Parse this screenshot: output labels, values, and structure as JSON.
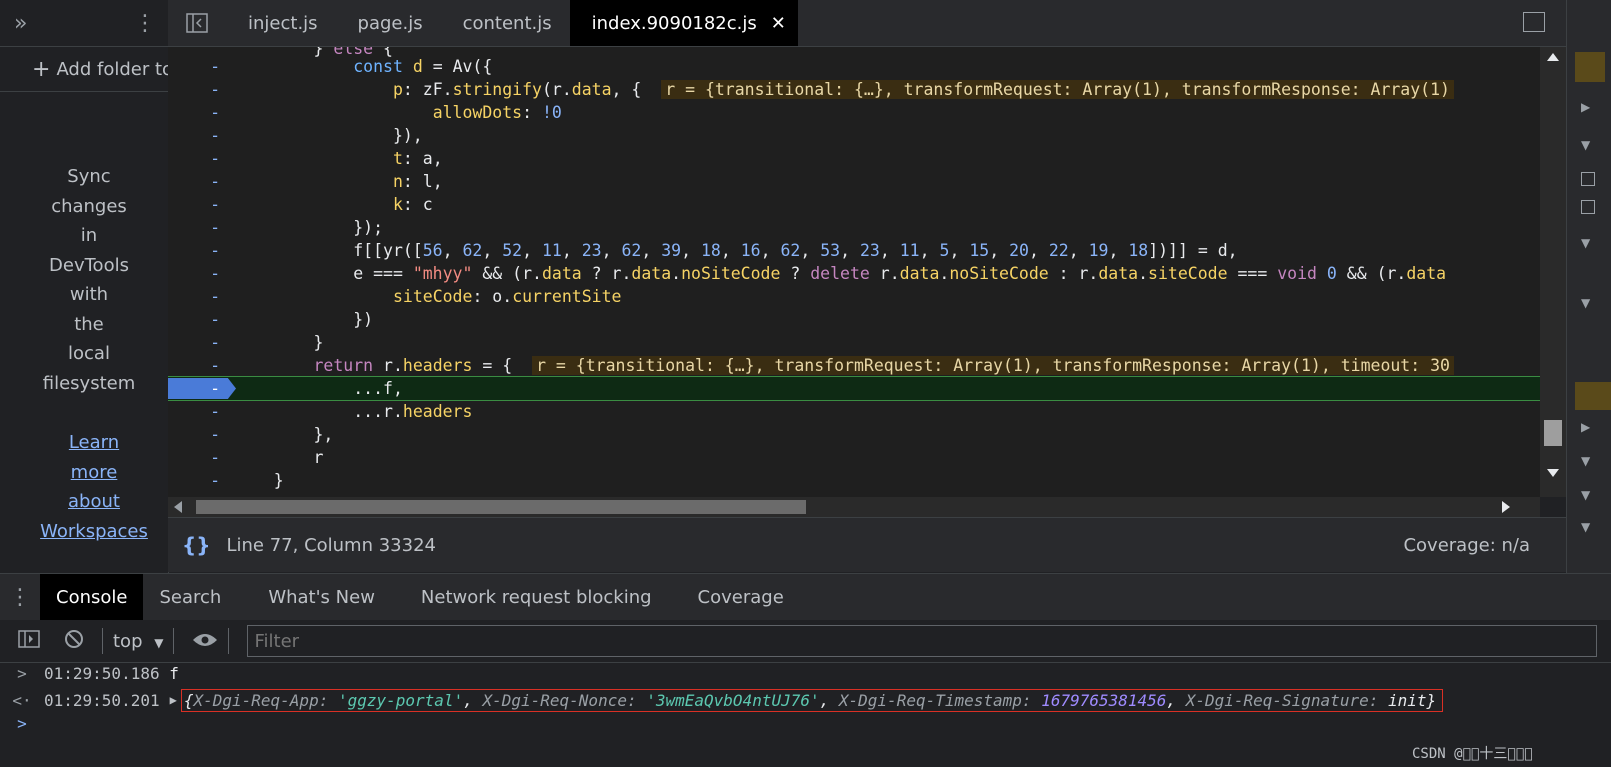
{
  "sidebar": {
    "add_folder": "Add folder to workspace",
    "sync_lines": [
      "Sync",
      "changes",
      "in",
      "DevTools",
      "with",
      "the",
      "local",
      "filesystem"
    ],
    "learn_lines": [
      "Learn",
      "more",
      "about",
      "Workspaces"
    ]
  },
  "tabs": [
    {
      "label": "inject.js"
    },
    {
      "label": "page.js"
    },
    {
      "label": "content.js"
    },
    {
      "label": "index.9090182c.js"
    }
  ],
  "status": {
    "position": "Line 77, Column 33324",
    "coverage": "Coverage: n/a"
  },
  "drawer": {
    "tabs": [
      "Console",
      "Search",
      "What's New",
      "Network request blocking",
      "Coverage"
    ],
    "context": "top",
    "filter_placeholder": "Filter"
  },
  "console": {
    "line1": {
      "time": "01:29:50.186",
      "text": "f"
    },
    "line2": {
      "time": "01:29:50.201",
      "k1": "X-Dgi-Req-App",
      "v1": "'ggzy-portal'",
      "k2": "X-Dgi-Req-Nonce",
      "v2": "'3wmEaQvbO4ntUJ76'",
      "k3": "X-Dgi-Req-Timestamp",
      "v3": "1679765381456",
      "k4": "X-Dgi-Req-Signature",
      "v4": "init"
    }
  },
  "code_inline": {
    "r1": "r = {transitional: {…}, transformRequest: Array(1), transformResponse: Array(1)",
    "r2": "r = {transitional: {…}, transformRequest: Array(1), transformResponse: Array(1), timeout: 30"
  },
  "watermark": "CSDN @\u0000\u0000十三\u0000\u0000\u0000",
  "colors": {
    "breakpoint": "#4a7bd8",
    "highlight_border": "#d93025",
    "link": "#8ab4f8"
  }
}
